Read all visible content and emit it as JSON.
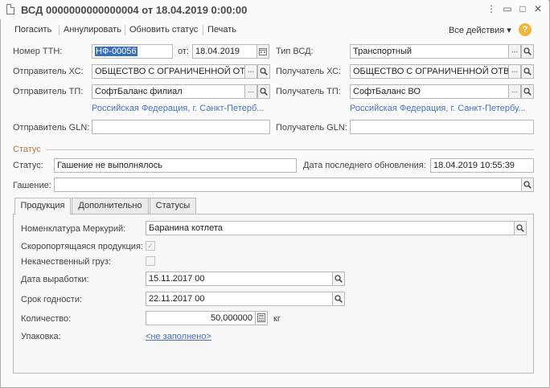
{
  "window": {
    "title": "ВСД 0000000000000004 от 18.04.2019 0:00:00",
    "controls": {
      "menu": "⋮",
      "minimize": "▭",
      "maximize": "□",
      "close": "✕"
    }
  },
  "toolbar": {
    "items": [
      "Погасить",
      "Аннулировать",
      "Обновить статус",
      "Печать"
    ],
    "all_actions": "Все действия ▾",
    "help": "?"
  },
  "form": {
    "ttn_label": "Номер ТТН:",
    "ttn_value": "НФ-00056",
    "from_label": "от:",
    "from_value": "18.04.2019",
    "vsd_type_label": "Тип ВСД:",
    "vsd_type_value": "Транспортный",
    "sender_hs_label": "Отправитель ХС:",
    "sender_hs_value": "ОБЩЕСТВО С ОГРАНИЧЕННОЙ ОТВЕТСТВЕННОСТЬЮ",
    "receiver_hs_label": "Получатель ХС:",
    "receiver_hs_value": "ОБЩЕСТВО С ОГРАНИЧЕННОЙ ОТВЕТСТВЕННОСТЬЮ",
    "sender_tp_label": "Отправитель ТП:",
    "sender_tp_value": "СофтБаланс филиал",
    "receiver_tp_label": "Получатель ТП:",
    "receiver_tp_value": "СофтБаланс ВО",
    "sender_address": "Российская Федерация, г. Санкт-Петерб...",
    "receiver_address": "Российская Федерация, г. Санкт-Петербу...",
    "sender_gln_label": "Отправитель GLN:",
    "sender_gln_value": "",
    "receiver_gln_label": "Получатель GLN:",
    "receiver_gln_value": ""
  },
  "status": {
    "section_title": "Статус",
    "status_label": "Статус:",
    "status_value": "Гашение не выполнялось",
    "last_update_label": "Дата последнего обновления:",
    "last_update_value": "18.04.2019 10:55:39",
    "gashenie_label": "Гашение:",
    "gashenie_value": ""
  },
  "tabs": [
    "Продукция",
    "Дополнительно",
    "Статусы"
  ],
  "product": {
    "nomenclature_label": "Номенклатура Меркурий:",
    "nomenclature_value": "Баранина котлета",
    "perishable_label": "Скоропортящаяся продукция:",
    "perishable_checked": true,
    "defective_label": "Некачественный груз:",
    "defective_checked": false,
    "production_date_label": "Дата выработки:",
    "production_date_value": "15.11.2017 00",
    "expiry_label": "Срок годности:",
    "expiry_value": "22.11.2017 00",
    "quantity_label": "Количество:",
    "quantity_value": "50,000000",
    "quantity_unit": "кг",
    "packaging_label": "Упаковка:",
    "packaging_value": "<не заполнено>"
  },
  "glyphs": {
    "ellipsis": "...",
    "check": "✓"
  },
  "icons": {
    "search": "magnifier-icon",
    "calendar": "calendar-icon",
    "calculator": "calculator-icon"
  },
  "colors": {
    "link": "#4b72b8",
    "section": "#b57a3e",
    "selection": "#3a6fb5",
    "help": "#f1b53a"
  }
}
